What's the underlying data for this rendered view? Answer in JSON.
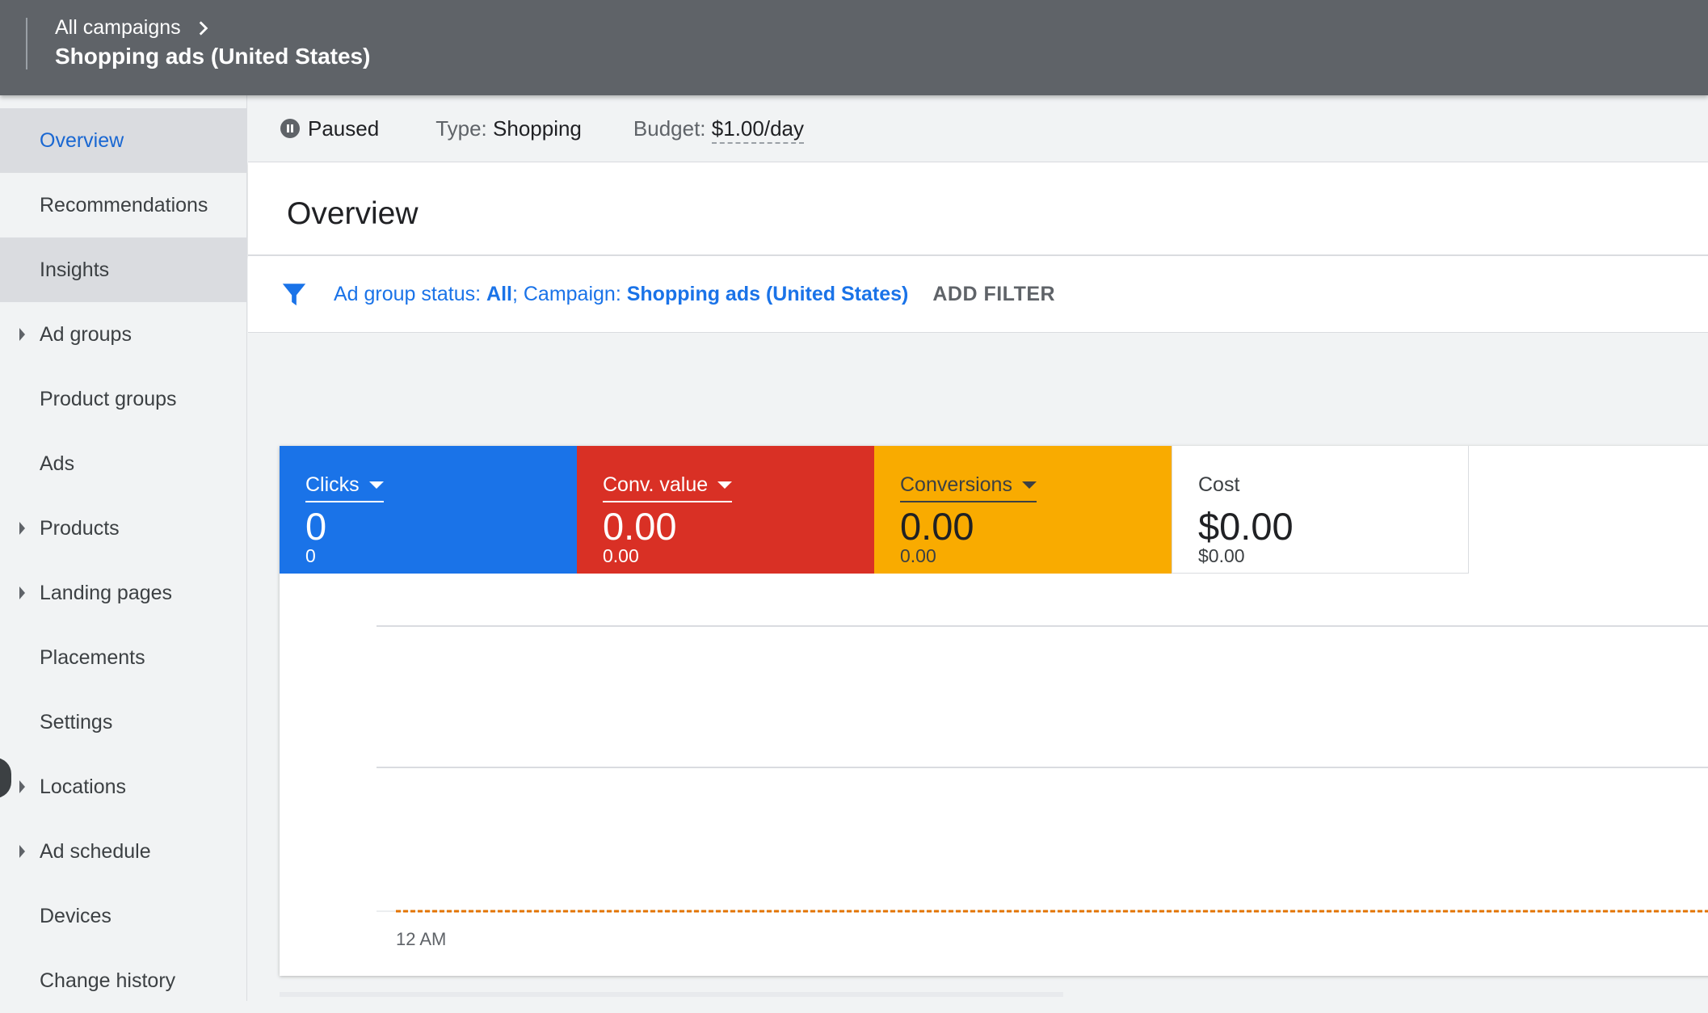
{
  "header": {
    "breadcrumb": "All campaigns",
    "campaign_name": "Shopping ads (United States)"
  },
  "sidebar": {
    "items": [
      {
        "label": "Overview"
      },
      {
        "label": "Recommendations"
      },
      {
        "label": "Insights"
      },
      {
        "label": "Ad groups"
      },
      {
        "label": "Product groups"
      },
      {
        "label": "Ads"
      },
      {
        "label": "Products"
      },
      {
        "label": "Landing pages"
      },
      {
        "label": "Placements"
      },
      {
        "label": "Settings"
      },
      {
        "label": "Locations"
      },
      {
        "label": "Ad schedule"
      },
      {
        "label": "Devices"
      },
      {
        "label": "Change history"
      }
    ]
  },
  "status_bar": {
    "status": "Paused",
    "type_label": "Type:",
    "type_value": "Shopping",
    "budget_label": "Budget:",
    "budget_value": "$1.00/day"
  },
  "page": {
    "title": "Overview"
  },
  "filter": {
    "status_label": "Ad group status:",
    "status_value": "All",
    "separator": ";",
    "campaign_label": "Campaign:",
    "campaign_value": "Shopping ads (United States)",
    "add_filter": "ADD FILTER"
  },
  "metrics": [
    {
      "name": "Clicks",
      "value": "0",
      "sub": "0",
      "color": "#1a73e8"
    },
    {
      "name": "Conv. value",
      "value": "0.00",
      "sub": "0.00",
      "color": "#d93025"
    },
    {
      "name": "Conversions",
      "value": "0.00",
      "sub": "0.00",
      "color": "#f9ab00"
    },
    {
      "name": "Cost",
      "value": "$0.00",
      "sub": "$0.00",
      "color": "#ffffff"
    }
  ],
  "chart_data": {
    "type": "line",
    "x": [
      "12 AM"
    ],
    "series": [
      {
        "values": [
          0
        ],
        "color": "#e37400",
        "style": "dashed"
      }
    ],
    "grid": true
  }
}
